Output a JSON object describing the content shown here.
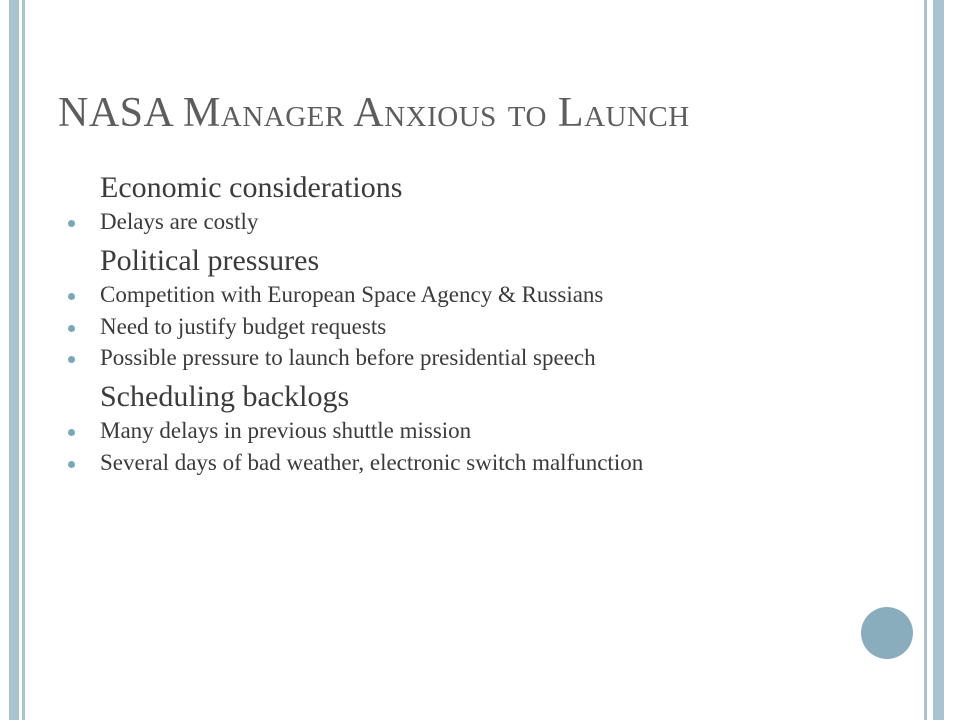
{
  "slide": {
    "title": "NASA Manager Anxious to Launch",
    "accent_color": "#a8c4d0",
    "bullet_color": "#7ba7bb",
    "title_color": "#5d5d5d",
    "circle_color": "#8aadbe",
    "background_color": "#ffffff",
    "groups": [
      {
        "heading": "Economic considerations",
        "items": [
          "Delays are costly"
        ]
      },
      {
        "heading": "Political pressures",
        "items": [
          "Competition with European Space Agency & Russians",
          "Need to justify budget requests",
          "Possible pressure to launch before presidential speech"
        ]
      },
      {
        "heading": "Scheduling backlogs",
        "items": [
          "Many delays in previous shuttle mission",
          "Several days of bad weather, electronic switch malfunction"
        ]
      }
    ]
  }
}
